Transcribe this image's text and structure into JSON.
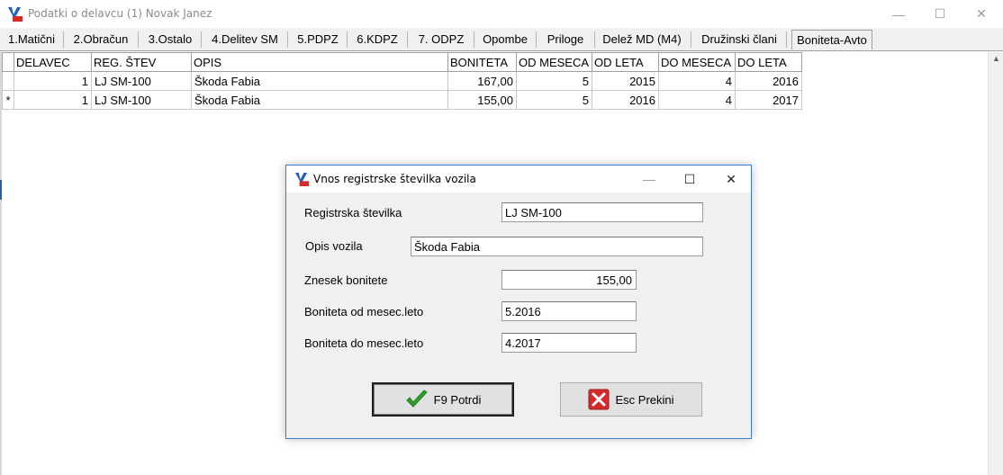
{
  "window": {
    "title": "Podatki o delavcu (1) Novak Janez",
    "minimize": "—",
    "maximize": "☐",
    "close": "✕"
  },
  "tabs": [
    {
      "label": "1.Matični"
    },
    {
      "label": "2.Obračun"
    },
    {
      "label": "3.Ostalo"
    },
    {
      "label": "4.Delitev SM"
    },
    {
      "label": "5.PDPZ"
    },
    {
      "label": "6.KDPZ"
    },
    {
      "label": "7. ODPZ"
    },
    {
      "label": "Opombe"
    },
    {
      "label": "Priloge"
    },
    {
      "label": "Delež MD (M4)"
    },
    {
      "label": "Družinski člani"
    },
    {
      "label": "Boniteta-Avto"
    }
  ],
  "grid": {
    "columns": [
      "DELAVEC",
      "REG. ŠTEV",
      "OPIS",
      "BONITETA",
      "OD MESECA",
      "OD LETA",
      "DO MESECA",
      "DO LETA"
    ],
    "rows": [
      {
        "indicator": "",
        "delavec": "1",
        "reg": "LJ SM-100",
        "opis": "Škoda Fabia",
        "boniteta": "167,00",
        "od_meseca": "5",
        "od_leta": "2015",
        "do_meseca": "4",
        "do_leta": "2016"
      },
      {
        "indicator": "*",
        "delavec": "1",
        "reg": "LJ SM-100",
        "opis": "Škoda Fabia",
        "boniteta": "155,00",
        "od_meseca": "5",
        "od_leta": "2016",
        "do_meseca": "4",
        "do_leta": "2017"
      }
    ]
  },
  "dialog": {
    "title": "Vnos registrske številka vozila",
    "minimize": "—",
    "maximize": "☐",
    "close": "✕",
    "reg_label": "Registrska številka",
    "reg_value": "LJ SM-100",
    "opis_label": "Opis vozila",
    "opis_value": "Škoda Fabia",
    "znesek_label": "Znesek bonitete",
    "znesek_value": "155,00",
    "od_label": "Boniteta od mesec.leto",
    "od_value": "5.2016",
    "do_label": "Boniteta do mesec.leto",
    "do_value": "4.2017",
    "confirm_label": "F9 Potrdi",
    "cancel_label": "Esc Prekini"
  },
  "icons": {
    "app": "app-logo-icon",
    "confirm": "checkmark-icon",
    "cancel": "red-x-icon"
  },
  "colors": {
    "dialog_border": "#3a7bd5",
    "check_green": "#2fa12f",
    "cancel_red": "#d42a2a"
  }
}
